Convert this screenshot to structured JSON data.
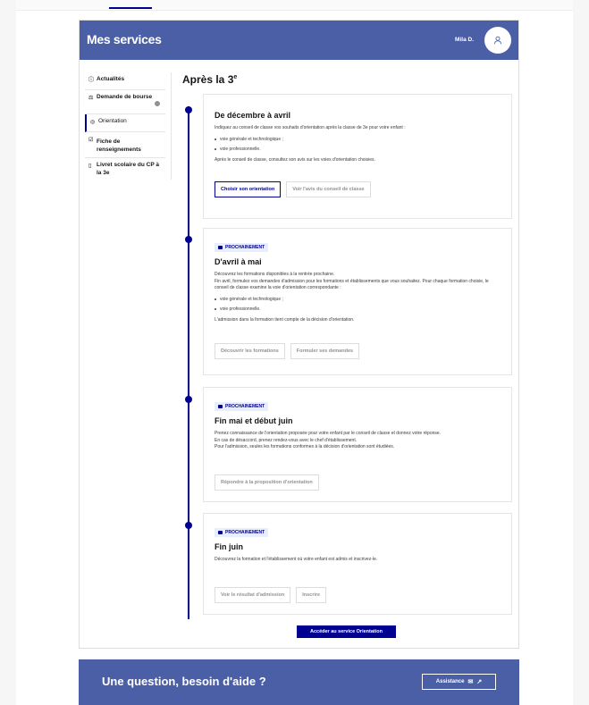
{
  "header": {
    "title": "Mes services",
    "user_name": "Mila D."
  },
  "sidebar": {
    "items": [
      {
        "label": "Actualités",
        "icon": "info-icon"
      },
      {
        "label": "Demande de bourse",
        "icon": "scale-icon"
      },
      {
        "label": "Orientation",
        "icon": "compass-icon"
      },
      {
        "label": "Fiche de renseignements",
        "icon": "form-icon"
      },
      {
        "label": "Livret scolaire du CP à la 3e",
        "icon": "book-icon"
      }
    ]
  },
  "main": {
    "title": "Après la 3",
    "title_sup": "e",
    "steps": [
      {
        "title": "De décembre à avril",
        "intro": "Indiquez au conseil de classe vos souhaits d'orientation après la classe de 3e pour votre enfant :",
        "items": [
          "voie générale et technologique ;",
          "voie professionnelle."
        ],
        "outro": "Après le conseil de classe, consultez son avis sur les voies d'orientation choisies.",
        "buttons": [
          "Choisir son orientation",
          "Voir l'avis du conseil de classe"
        ]
      },
      {
        "badge": "PROCHAINEMENT",
        "title": "D'avril à mai",
        "intro": "Découvrez les formations disponibles à la rentrée prochaine.",
        "intro2": "Fin avril, formulez vos demandes d'admission pour les formations et établissements que vous souhaitez. Pour chaque formation choisie, le conseil de classe examine la voie d'orientation correspondante :",
        "items": [
          "voie générale et technologique ;",
          "voie professionnelle."
        ],
        "outro": "L'admission dans la formation tient compte de la décision d'orientation.",
        "buttons": [
          "Découvrir les formations",
          "Formuler ses demandes"
        ]
      },
      {
        "badge": "PROCHAINEMENT",
        "title": "Fin mai et début juin",
        "line1": "Prenez connaissance de l'orientation proposée pour votre enfant par le conseil de classe et donnez votre réponse.",
        "line2": "En cas de désaccord, prenez rendez-vous avec le chef d'établissement.",
        "line3": "Pour l'admission, seules les formations conformes à la décision d'orientation sont étudiées.",
        "buttons": [
          "Répondre à la proposition d'orientation"
        ]
      },
      {
        "badge": "PROCHAINEMENT",
        "title": "Fin juin",
        "line1": "Découvrez la formation et l'établissement où votre enfant est admis et inscrivez-le.",
        "buttons": [
          "Voir le résultat d'admission",
          "Inscrire"
        ]
      }
    ],
    "access_button": "Accéder au service Orientation"
  },
  "help": {
    "title": "Une question, besoin d'aide ?",
    "button": "Assistance"
  },
  "colors": {
    "brand_blue": "#000091",
    "header_bg": "#4b5fa7"
  }
}
